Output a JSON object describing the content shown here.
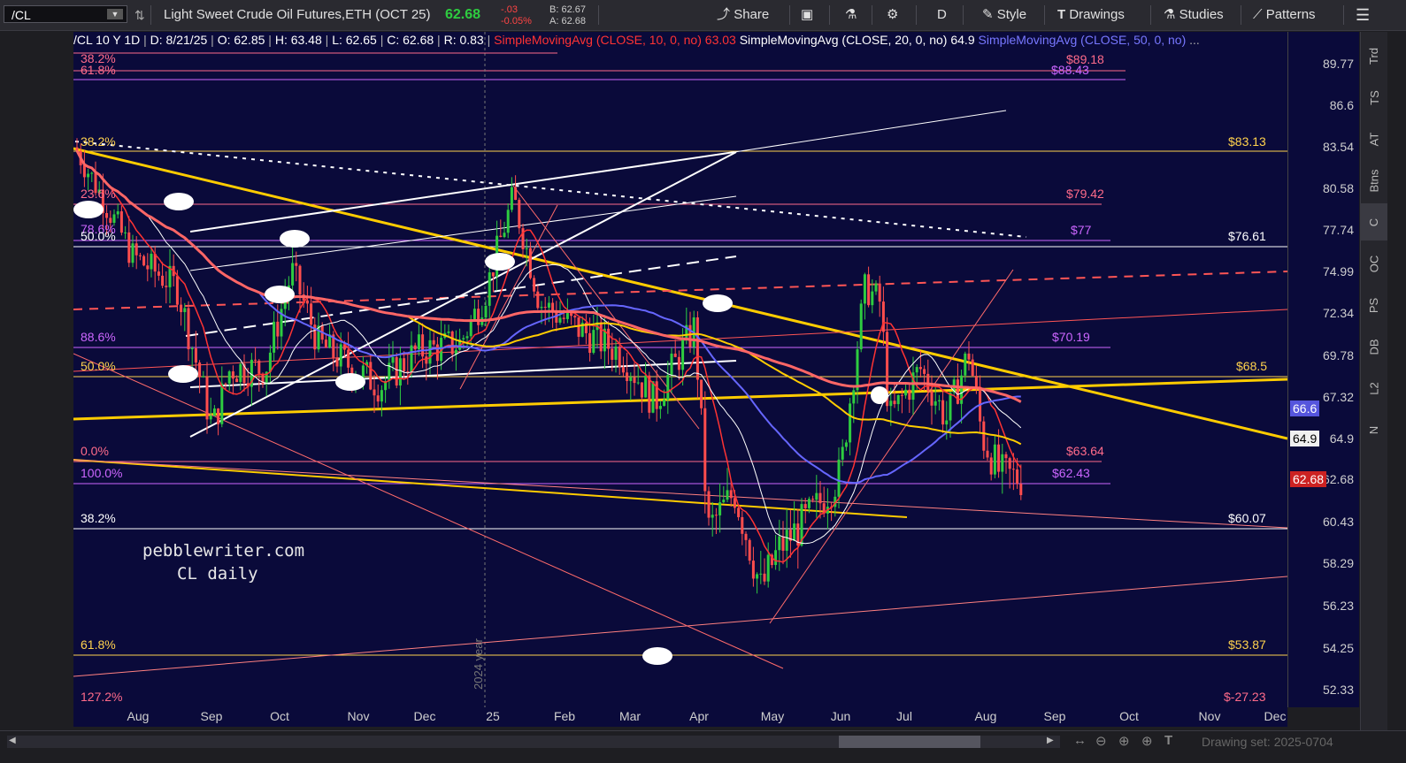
{
  "toolbar": {
    "symbol": "/CL",
    "description": "Light Sweet Crude Oil Futures,ETH (OCT 25)",
    "last": "62.68",
    "change": "-.03",
    "change_pct": "-0.05%",
    "bid": "B: 62.67",
    "ask": "A: 62.68",
    "share": "Share",
    "aggregation": "D",
    "style": "Style",
    "drawings": "Drawings",
    "studies": "Studies",
    "patterns": "Patterns"
  },
  "chart_header": {
    "symbol_period": "/CL 10 Y 1D",
    "date": "D: 8/21/25",
    "open": "O: 62.85",
    "high": "H: 63.48",
    "low": "L: 62.65",
    "close": "C: 62.68",
    "range": "R: 0.83",
    "sma10_label": "SimpleMovingAvg (CLOSE, 10, 0, no)",
    "sma10_value": "63.03",
    "sma20_label": "SimpleMovingAvg (CLOSE, 20, 0, no)",
    "sma20_value": "64.9",
    "sma50_label": "SimpleMovingAvg (CLOSE, 50, 0, no)",
    "more": "..."
  },
  "y_axis": {
    "labels": [
      "89.77",
      "86.6",
      "83.54",
      "80.58",
      "77.74",
      "74.99",
      "72.34",
      "69.78",
      "67.32",
      "64.9",
      "62.68",
      "60.43",
      "58.29",
      "56.23",
      "54.25",
      "52.33"
    ],
    "tags": [
      {
        "text": "66.6",
        "bg": "#5555dd",
        "fg": "#ffffff"
      },
      {
        "text": "64.9",
        "bg": "#f0f0f0",
        "fg": "#000000"
      },
      {
        "text": "62.68",
        "bg": "#cc2222",
        "fg": "#ffffff"
      }
    ]
  },
  "x_axis": {
    "labels": [
      "Aug",
      "Sep",
      "Oct",
      "Nov",
      "Dec",
      "25",
      "Feb",
      "Mar",
      "Apr",
      "May",
      "Jun",
      "Jul",
      "Aug",
      "Sep",
      "Oct",
      "Nov",
      "Dec"
    ],
    "year_marker": "2024 year"
  },
  "fib_levels_left": [
    {
      "text": "38.2%",
      "color": "#ff6b8a"
    },
    {
      "text": "61.8%",
      "color": "#ff6b8a"
    },
    {
      "text": "38.2%",
      "color": "#ffd24d"
    },
    {
      "text": "23.6%",
      "color": "#ff6b8a"
    },
    {
      "text": "78.6%",
      "color": "#cc66ff"
    },
    {
      "text": "50.0%",
      "color": "#ffffff"
    },
    {
      "text": "88.6%",
      "color": "#cc66ff"
    },
    {
      "text": "50.0%",
      "color": "#ffd24d"
    },
    {
      "text": "0.0%",
      "color": "#ff6b8a"
    },
    {
      "text": "100.0%",
      "color": "#cc66ff"
    },
    {
      "text": "38.2%",
      "color": "#ffffff"
    },
    {
      "text": "61.8%",
      "color": "#ffd24d"
    },
    {
      "text": "127.2%",
      "color": "#ff6b8a"
    }
  ],
  "price_levels_right": [
    {
      "text": "$89.18",
      "color": "#ff6b8a"
    },
    {
      "text": "$88.43",
      "color": "#cc66ff"
    },
    {
      "text": "$83.13",
      "color": "#ffd24d"
    },
    {
      "text": "$79.42",
      "color": "#ff6b8a"
    },
    {
      "text": "$77",
      "color": "#cc66ff"
    },
    {
      "text": "$76.61",
      "color": "#ffffff"
    },
    {
      "text": "$70.19",
      "color": "#cc66ff"
    },
    {
      "text": "$68.5",
      "color": "#ffd24d"
    },
    {
      "text": "$63.64",
      "color": "#ff6b8a"
    },
    {
      "text": "$62.43",
      "color": "#cc66ff"
    },
    {
      "text": "$60.07",
      "color": "#ffffff"
    },
    {
      "text": "$53.87",
      "color": "#ffd24d"
    },
    {
      "text": "$-27.23",
      "color": "#ff6b8a"
    }
  ],
  "watermark": {
    "line1": "pebblewriter.com",
    "line2": "CL daily"
  },
  "right_tabs": [
    "Trd",
    "TS",
    "AT",
    "Btns",
    "C",
    "OC",
    "PS",
    "DB",
    "L2",
    "N"
  ],
  "bottom": {
    "drawing_set": "Drawing set: 2025-0704"
  },
  "colors": {
    "chart_bg": "#0a0a3a",
    "up": "#2ecc40",
    "down": "#ff4d4d",
    "sma10": "#ff3333",
    "sma20": "#ffffff",
    "sma50": "#6666ff",
    "sma200": "#ffcc00",
    "sma100": "#ff6666"
  }
}
